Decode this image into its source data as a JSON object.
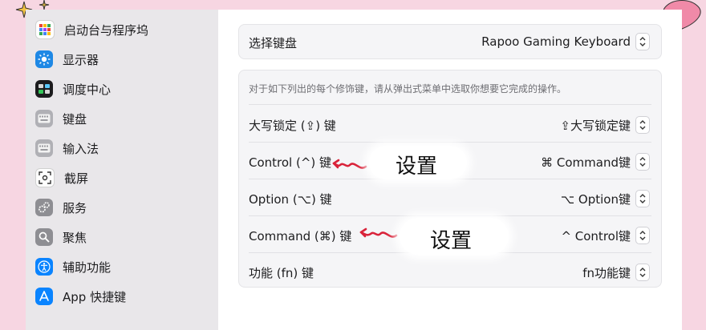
{
  "sidebar": {
    "items": [
      {
        "label": "启动台与程序坞",
        "icon": "grid-icon"
      },
      {
        "label": "显示器",
        "icon": "sun-icon"
      },
      {
        "label": "调度中心",
        "icon": "mission-control-icon"
      },
      {
        "label": "键盘",
        "icon": "keyboard-icon"
      },
      {
        "label": "输入法",
        "icon": "keyboard-icon"
      },
      {
        "label": "截屏",
        "icon": "screenshot-icon"
      },
      {
        "label": "服务",
        "icon": "gear-icon"
      },
      {
        "label": "聚焦",
        "icon": "magnifier-icon"
      },
      {
        "label": "辅助功能",
        "icon": "accessibility-icon"
      },
      {
        "label": "App 快捷键",
        "icon": "app-store-icon"
      }
    ]
  },
  "keyboard_select": {
    "label": "选择键盘",
    "value": "Rapoo Gaming Keyboard"
  },
  "description": "对于如下列出的每个修饰键，请从弹出式菜单中选取你想要它完成的操作。",
  "modifier_rows": [
    {
      "label": "大写锁定 (⇪) 键",
      "value": "⇪大写锁定键"
    },
    {
      "label": "Control (^) 键",
      "value": "⌘ Command键"
    },
    {
      "label": "Option (⌥) 键",
      "value": "⌥ Option键"
    },
    {
      "label": "Command (⌘) 键",
      "value": "^ Control键"
    },
    {
      "label": "功能 (fn) 键",
      "value": "fn功能键"
    }
  ],
  "annotations": {
    "note1": "设置",
    "note2": "设置"
  },
  "colors": {
    "accent_red": "#d9233a",
    "window_bg": "#f7d6e2",
    "sidebar_bg": "#e9e7ea"
  }
}
